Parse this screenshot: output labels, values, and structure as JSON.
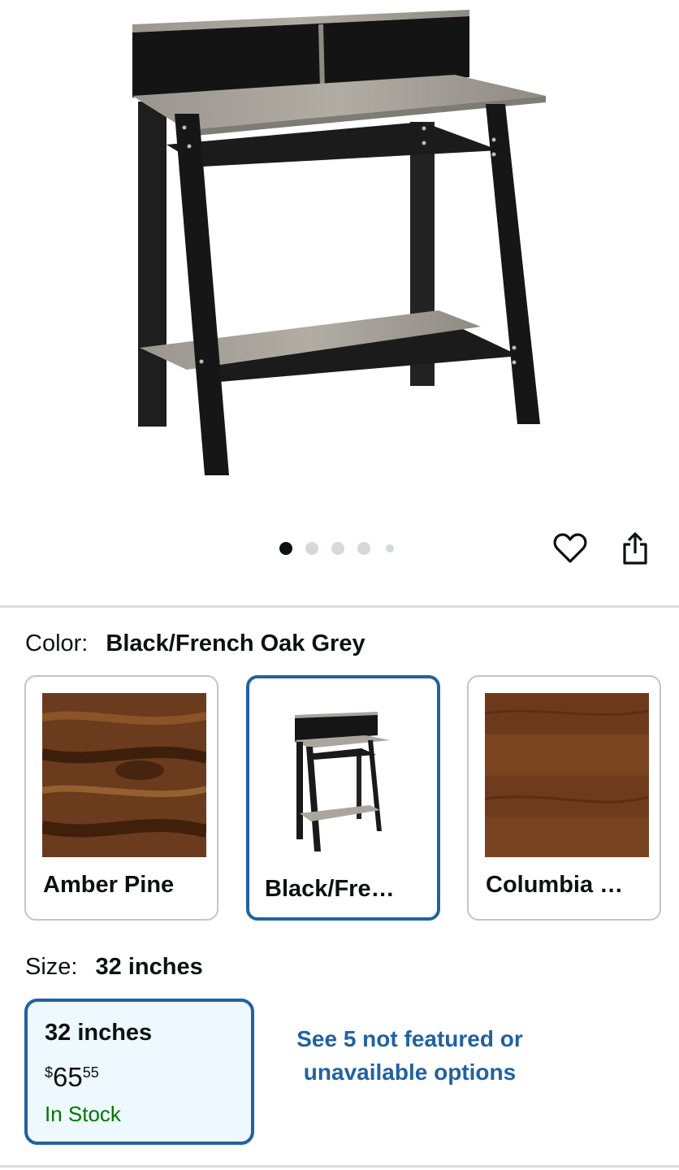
{
  "gallery": {
    "image_count": 5,
    "active_index": 0,
    "wishlist_icon": "heart-icon",
    "share_icon": "share-icon"
  },
  "color": {
    "label": "Color:",
    "selected": "Black/French Oak Grey",
    "options": [
      {
        "name": "Amber Pine",
        "swatch": "#6a3b1c"
      },
      {
        "name": "Black/Fre…",
        "swatch": "product-thumbnail"
      },
      {
        "name": "Columbia …",
        "swatch": "#74401f"
      }
    ]
  },
  "size": {
    "label": "Size:",
    "selected": "32 inches",
    "options": [
      {
        "name": "32 inches",
        "price_symbol": "$",
        "price_whole": "65",
        "price_fraction": "55",
        "stock": "In Stock"
      }
    ],
    "more_link": "See 5 not featured or unavailable options"
  },
  "colors": {
    "link": "#2162a1",
    "stock": "#007600",
    "selected_bg": "#edf8ff"
  }
}
